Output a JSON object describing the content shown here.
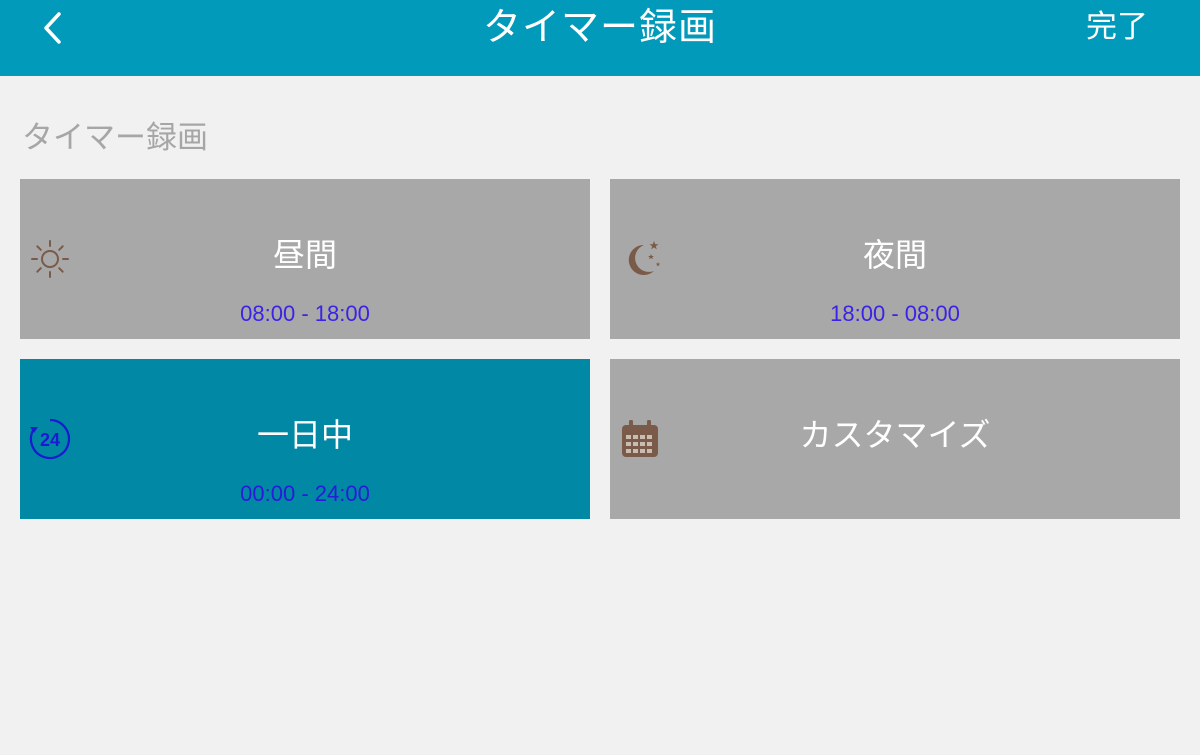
{
  "header": {
    "title": "タイマー録画",
    "done_label": "完了",
    "back_icon": "chevron-left-icon",
    "background": "#019aba"
  },
  "section": {
    "label": "タイマー録画"
  },
  "presets": [
    {
      "id": "day",
      "label": "昼間",
      "time": "08:00 - 18:00",
      "icon": "sun-icon",
      "selected": false
    },
    {
      "id": "night",
      "label": "夜間",
      "time": "18:00 - 08:00",
      "icon": "moon-stars-icon",
      "selected": false
    },
    {
      "id": "allday",
      "label": "一日中",
      "time": "00:00 - 24:00",
      "icon": "clock-24-icon",
      "selected": true
    },
    {
      "id": "custom",
      "label": "カスタマイズ",
      "time": "",
      "icon": "calendar-icon",
      "selected": false
    }
  ],
  "colors": {
    "tile": "#a8a8a8",
    "tile_selected": "#0188a5",
    "time_text": "#3a23e8",
    "icon_brown": "#7a5a48",
    "icon_blue": "#1a1ad0"
  }
}
